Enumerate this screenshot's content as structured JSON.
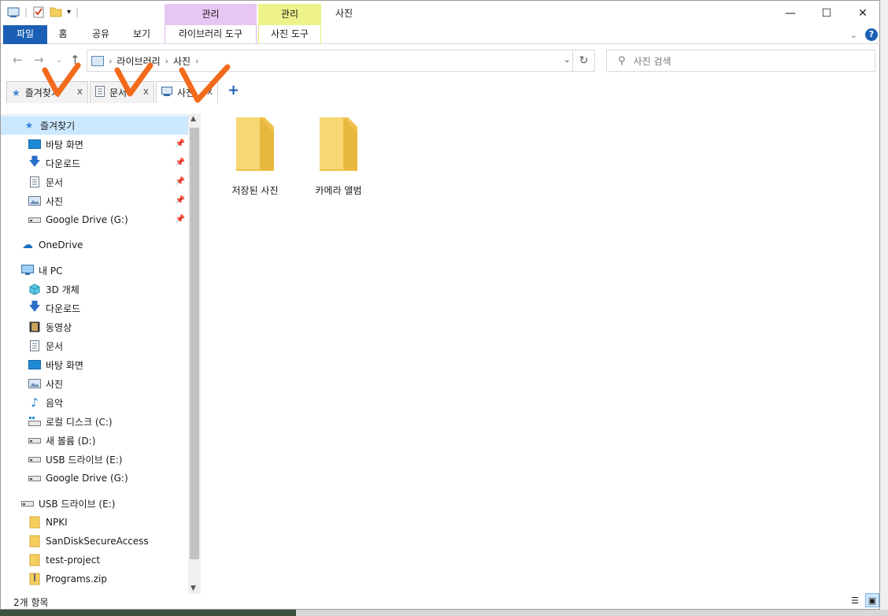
{
  "window": {
    "title": "사진",
    "context_tabs": [
      "관리",
      "관리"
    ],
    "controls": {
      "minimize": "—",
      "maximize": "☐",
      "close": "✕"
    }
  },
  "ribbon": {
    "tabs": [
      "파일",
      "홈",
      "공유",
      "보기",
      "라이브러리 도구",
      "사진 도구"
    ]
  },
  "address": {
    "crumbs": [
      "라이브러리",
      "사진"
    ],
    "search_placeholder": "사진 검색"
  },
  "tabs": [
    {
      "label": "즐겨찾기",
      "icon": "star-icon"
    },
    {
      "label": "문서",
      "icon": "document-icon"
    },
    {
      "label": "사진",
      "icon": "pictures-icon",
      "active": true
    }
  ],
  "nav": {
    "quick_access": "즐겨찾기",
    "quick_items": [
      "바탕 화면",
      "다운로드",
      "문서",
      "사진",
      "Google Drive (G:)"
    ],
    "onedrive": "OneDrive",
    "this_pc": "내 PC",
    "pc_items": [
      "3D 개체",
      "다운로드",
      "동영상",
      "문서",
      "바탕 화면",
      "사진",
      "음악",
      "로컬 디스크 (C:)",
      "새 볼륨 (D:)",
      "USB 드라이브 (E:)",
      "Google Drive (G:)"
    ],
    "usb": "USB 드라이브 (E:)",
    "usb_items": [
      "NPKI",
      "SanDiskSecureAccess",
      "test-project",
      "Programs.zip"
    ]
  },
  "content": {
    "folders": [
      "저장된 사진",
      "카메라 앨범"
    ]
  },
  "status": {
    "count": "2개 항목"
  },
  "colors": {
    "accent": "#1a5fb4",
    "selection": "#cce8ff",
    "manage_purple": "#e8c6f3",
    "manage_yellow": "#eef28a",
    "check_orange": "#f26a1b",
    "folder": "#f5cf5d"
  }
}
